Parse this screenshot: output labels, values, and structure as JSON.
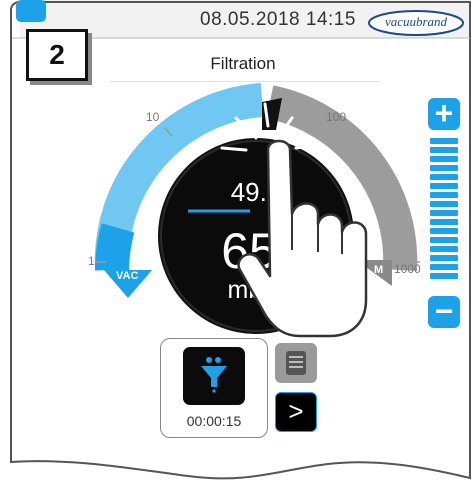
{
  "header": {
    "datetime": "08.05.2018  14:15",
    "brand": "vacuubrand",
    "home_icon": "home-icon"
  },
  "step_badge": "2",
  "title": "Filtration",
  "gauge": {
    "setpoint": "49.5",
    "value": "65.",
    "unit": "mbar",
    "ticks": [
      "1",
      "10",
      "100",
      "1000"
    ],
    "left_tag": "VAC",
    "right_tag": "M",
    "scale": "log",
    "range": [
      1,
      1000
    ],
    "colors": {
      "accent": "#1da1e8",
      "dial": "#111111",
      "track": "#999999"
    }
  },
  "controls": {
    "plus_label": "+",
    "minus_label": "−",
    "slider_level": 1.0
  },
  "mode": {
    "icon": "filtration-funnel-icon",
    "timer": "00:00:15"
  },
  "list_button_icon": "list-icon",
  "next_label": ">"
}
